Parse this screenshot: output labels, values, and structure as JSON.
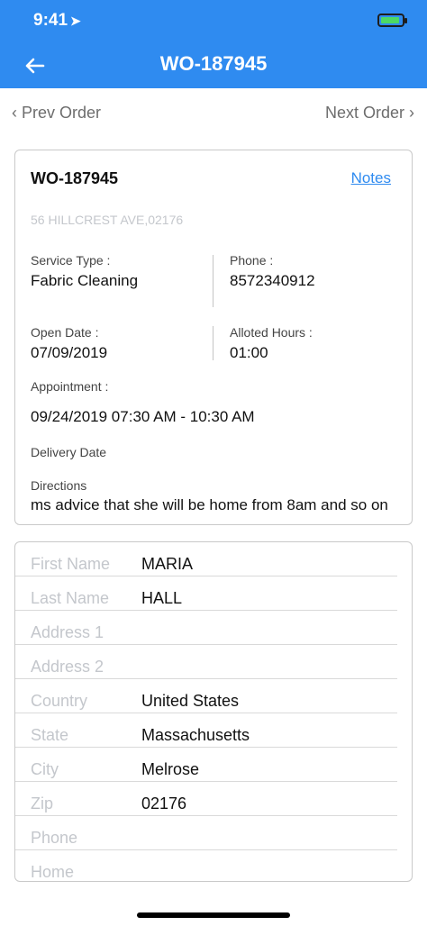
{
  "status": {
    "time": "9:41",
    "location_arrow": "➤"
  },
  "header": {
    "title": "WO-187945",
    "back_icon": "arrow-left"
  },
  "nav": {
    "prev": "‹  Prev Order",
    "next": "Next Order  ›"
  },
  "order": {
    "id": "WO-187945",
    "notes": "Notes",
    "address": "56 HILLCREST AVE,02176",
    "service_type_label": "Service Type :",
    "service_type": "Fabric Cleaning",
    "phone_label": "Phone :",
    "phone": "8572340912",
    "open_date_label": "Open Date :",
    "open_date": "07/09/2019",
    "alloted_hours_label": "Alloted Hours :",
    "alloted_hours": "01:00",
    "appointment_label": "Appointment :",
    "appointment": "09/24/2019 07:30 AM - 10:30 AM",
    "delivery_date_label": "Delivery Date",
    "directions_label": "Directions",
    "directions": "ms advice that she will be home from 8am and so on"
  },
  "customer": {
    "rows": [
      {
        "label": "First Name",
        "value": "MARIA"
      },
      {
        "label": "Last Name",
        "value": "HALL"
      },
      {
        "label": "Address 1",
        "value": ""
      },
      {
        "label": "Address 2",
        "value": ""
      },
      {
        "label": "Country",
        "value": "United States"
      },
      {
        "label": "State",
        "value": "Massachusetts"
      },
      {
        "label": "City",
        "value": "Melrose"
      },
      {
        "label": "Zip",
        "value": "02176"
      },
      {
        "label": "Phone",
        "value": ""
      },
      {
        "label": "Home",
        "value": ""
      }
    ]
  },
  "colors": {
    "accent": "#2f8bf0",
    "battery": "#4cd964"
  }
}
